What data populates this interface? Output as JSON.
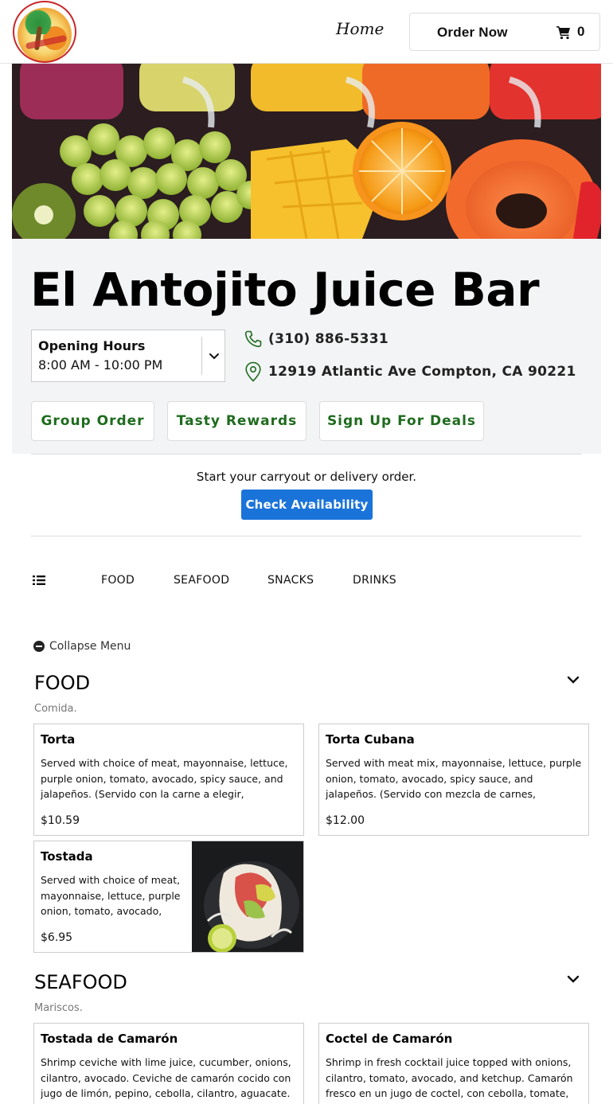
{
  "header": {
    "logo_icon": "restaurant-logo",
    "nav_home": "Home",
    "order_now": "Order Now",
    "cart_icon": "shopping-cart-icon",
    "cart_count": "0"
  },
  "hero": {
    "image_description_icon": "fruit-juice-banner"
  },
  "restaurant": {
    "name": "El Antojito Juice Bar",
    "hours_title": "Opening Hours",
    "hours_value": "8:00 AM - 10:00 PM",
    "phone": "(310) 886-5331",
    "address": "12919 Atlantic Ave Compton, CA 90221",
    "buttons": {
      "group_order": "Group Order",
      "tasty_rewards": "Tasty Rewards",
      "sign_up_deals": "Sign Up For Deals"
    },
    "accent_color": "#1e6b1e"
  },
  "availability": {
    "prompt": "Start your carryout or delivery order.",
    "button": "Check Availability",
    "button_color": "#1a73d9"
  },
  "category_nav": {
    "tabs": [
      "FOOD",
      "SEAFOOD",
      "SNACKS",
      "DRINKS"
    ]
  },
  "menu": {
    "collapse_label": "Collapse Menu",
    "sections": [
      {
        "title": "FOOD",
        "subtitle": "Comida.",
        "items": [
          {
            "name": "Torta",
            "description": "Served with choice of meat, mayonnaise, lettuce, purple onion, tomato, avocado, spicy sauce, and jalapeños. (Servido con la carne a elegir, mayonesa, lechuga, cebolla morada, tomate, aguacate, salsa picante y jalapeños.)",
            "price": "$10.59"
          },
          {
            "name": "Torta Cubana",
            "description": "Served with meat mix, mayonnaise, lettuce, purple onion, tomato, avocado, spicy sauce, and jalapeños. (Servido con mezcla de carnes, mayonesa, lechuga, cebolla morada, tomate, aguacate, salsa picante y jalapeños.)",
            "price": "$12.00"
          },
          {
            "name": "Tostada",
            "description": "Served with choice of meat, mayonnaise, lettuce, purple onion, tomato, avocado, spicy sauce.",
            "price": "$6.95"
          }
        ]
      },
      {
        "title": "SEAFOOD",
        "subtitle": "Mariscos.",
        "items": [
          {
            "name": "Tostada de Camarón",
            "description": "Shrimp ceviche with lime juice, cucumber, onions, cilantro, avocado. Ceviche de camarón cocido con jugo de limón, pepino, cebolla, cilantro, aguacate.",
            "price": ""
          },
          {
            "name": "Coctel de Camarón",
            "description": "Shrimp in fresh cocktail juice topped with onions, cilantro, tomato, avocado, and ketchup. Camarón fresco en un jugo de coctel, con cebolla, tomate, cilantro, aguacate y catsup.",
            "price": ""
          }
        ]
      }
    ]
  }
}
